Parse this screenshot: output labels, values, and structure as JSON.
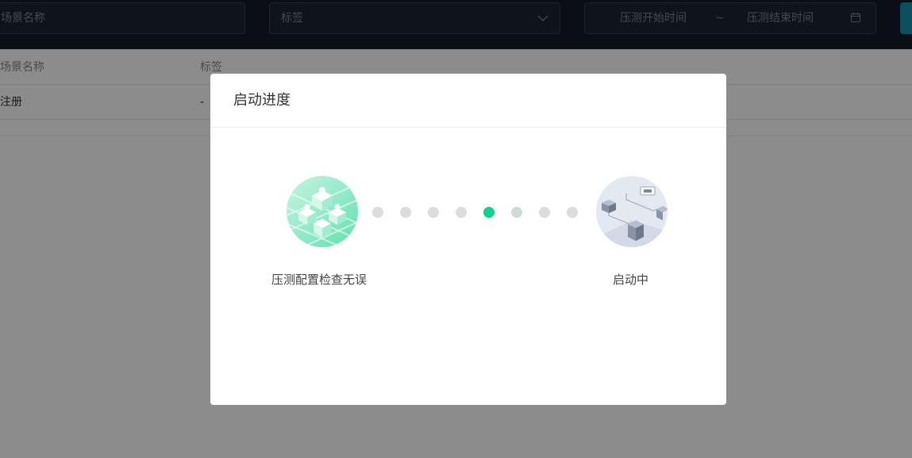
{
  "filters": {
    "scene_name_placeholder": "场景名称",
    "tag_placeholder": "标签",
    "date_start_placeholder": "压测开始时间",
    "date_separator": "~",
    "date_end_placeholder": "压测结束时间"
  },
  "table": {
    "headers": [
      "场景名称",
      "标签"
    ],
    "rows": [
      [
        "注册",
        "-"
      ]
    ]
  },
  "modal": {
    "title": "启动进度",
    "steps": [
      {
        "label": "压测配置检查无误",
        "icon": "layered-cubes-illustration"
      },
      {
        "label": "启动中",
        "icon": "server-network-illustration"
      }
    ],
    "progress": {
      "dot_count": 8,
      "active_index": 4
    }
  },
  "colors": {
    "topbar": "#151b28",
    "accent": "#12d18e",
    "primary_button": "#1593a8"
  }
}
